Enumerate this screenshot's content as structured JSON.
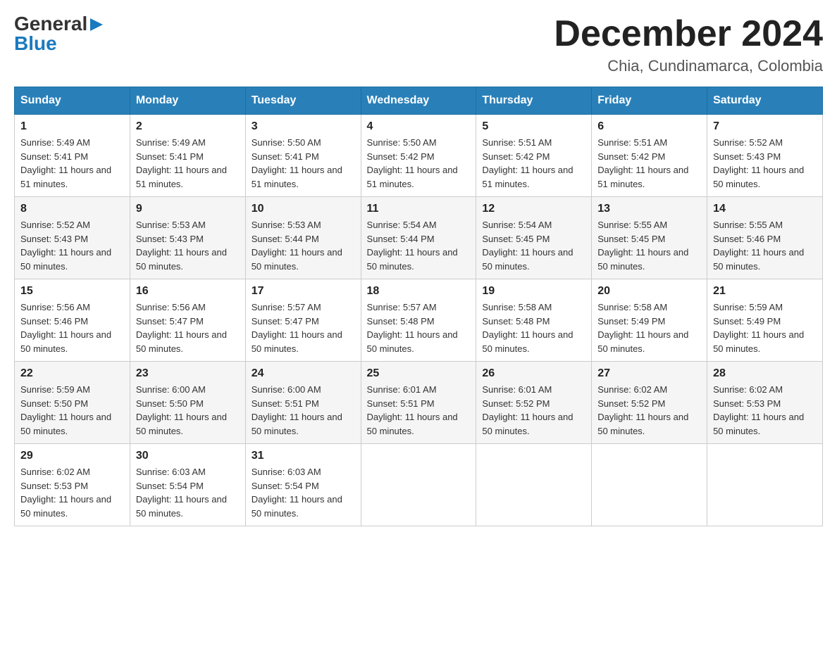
{
  "logo": {
    "general": "General",
    "blue": "Blue",
    "arrow": "▶"
  },
  "title": {
    "month_year": "December 2024",
    "location": "Chia, Cundinamarca, Colombia"
  },
  "headers": [
    "Sunday",
    "Monday",
    "Tuesday",
    "Wednesday",
    "Thursday",
    "Friday",
    "Saturday"
  ],
  "weeks": [
    [
      {
        "day": "1",
        "sunrise": "5:49 AM",
        "sunset": "5:41 PM",
        "daylight": "11 hours and 51 minutes."
      },
      {
        "day": "2",
        "sunrise": "5:49 AM",
        "sunset": "5:41 PM",
        "daylight": "11 hours and 51 minutes."
      },
      {
        "day": "3",
        "sunrise": "5:50 AM",
        "sunset": "5:41 PM",
        "daylight": "11 hours and 51 minutes."
      },
      {
        "day": "4",
        "sunrise": "5:50 AM",
        "sunset": "5:42 PM",
        "daylight": "11 hours and 51 minutes."
      },
      {
        "day": "5",
        "sunrise": "5:51 AM",
        "sunset": "5:42 PM",
        "daylight": "11 hours and 51 minutes."
      },
      {
        "day": "6",
        "sunrise": "5:51 AM",
        "sunset": "5:42 PM",
        "daylight": "11 hours and 51 minutes."
      },
      {
        "day": "7",
        "sunrise": "5:52 AM",
        "sunset": "5:43 PM",
        "daylight": "11 hours and 50 minutes."
      }
    ],
    [
      {
        "day": "8",
        "sunrise": "5:52 AM",
        "sunset": "5:43 PM",
        "daylight": "11 hours and 50 minutes."
      },
      {
        "day": "9",
        "sunrise": "5:53 AM",
        "sunset": "5:43 PM",
        "daylight": "11 hours and 50 minutes."
      },
      {
        "day": "10",
        "sunrise": "5:53 AM",
        "sunset": "5:44 PM",
        "daylight": "11 hours and 50 minutes."
      },
      {
        "day": "11",
        "sunrise": "5:54 AM",
        "sunset": "5:44 PM",
        "daylight": "11 hours and 50 minutes."
      },
      {
        "day": "12",
        "sunrise": "5:54 AM",
        "sunset": "5:45 PM",
        "daylight": "11 hours and 50 minutes."
      },
      {
        "day": "13",
        "sunrise": "5:55 AM",
        "sunset": "5:45 PM",
        "daylight": "11 hours and 50 minutes."
      },
      {
        "day": "14",
        "sunrise": "5:55 AM",
        "sunset": "5:46 PM",
        "daylight": "11 hours and 50 minutes."
      }
    ],
    [
      {
        "day": "15",
        "sunrise": "5:56 AM",
        "sunset": "5:46 PM",
        "daylight": "11 hours and 50 minutes."
      },
      {
        "day": "16",
        "sunrise": "5:56 AM",
        "sunset": "5:47 PM",
        "daylight": "11 hours and 50 minutes."
      },
      {
        "day": "17",
        "sunrise": "5:57 AM",
        "sunset": "5:47 PM",
        "daylight": "11 hours and 50 minutes."
      },
      {
        "day": "18",
        "sunrise": "5:57 AM",
        "sunset": "5:48 PM",
        "daylight": "11 hours and 50 minutes."
      },
      {
        "day": "19",
        "sunrise": "5:58 AM",
        "sunset": "5:48 PM",
        "daylight": "11 hours and 50 minutes."
      },
      {
        "day": "20",
        "sunrise": "5:58 AM",
        "sunset": "5:49 PM",
        "daylight": "11 hours and 50 minutes."
      },
      {
        "day": "21",
        "sunrise": "5:59 AM",
        "sunset": "5:49 PM",
        "daylight": "11 hours and 50 minutes."
      }
    ],
    [
      {
        "day": "22",
        "sunrise": "5:59 AM",
        "sunset": "5:50 PM",
        "daylight": "11 hours and 50 minutes."
      },
      {
        "day": "23",
        "sunrise": "6:00 AM",
        "sunset": "5:50 PM",
        "daylight": "11 hours and 50 minutes."
      },
      {
        "day": "24",
        "sunrise": "6:00 AM",
        "sunset": "5:51 PM",
        "daylight": "11 hours and 50 minutes."
      },
      {
        "day": "25",
        "sunrise": "6:01 AM",
        "sunset": "5:51 PM",
        "daylight": "11 hours and 50 minutes."
      },
      {
        "day": "26",
        "sunrise": "6:01 AM",
        "sunset": "5:52 PM",
        "daylight": "11 hours and 50 minutes."
      },
      {
        "day": "27",
        "sunrise": "6:02 AM",
        "sunset": "5:52 PM",
        "daylight": "11 hours and 50 minutes."
      },
      {
        "day": "28",
        "sunrise": "6:02 AM",
        "sunset": "5:53 PM",
        "daylight": "11 hours and 50 minutes."
      }
    ],
    [
      {
        "day": "29",
        "sunrise": "6:02 AM",
        "sunset": "5:53 PM",
        "daylight": "11 hours and 50 minutes."
      },
      {
        "day": "30",
        "sunrise": "6:03 AM",
        "sunset": "5:54 PM",
        "daylight": "11 hours and 50 minutes."
      },
      {
        "day": "31",
        "sunrise": "6:03 AM",
        "sunset": "5:54 PM",
        "daylight": "11 hours and 50 minutes."
      },
      null,
      null,
      null,
      null
    ]
  ]
}
